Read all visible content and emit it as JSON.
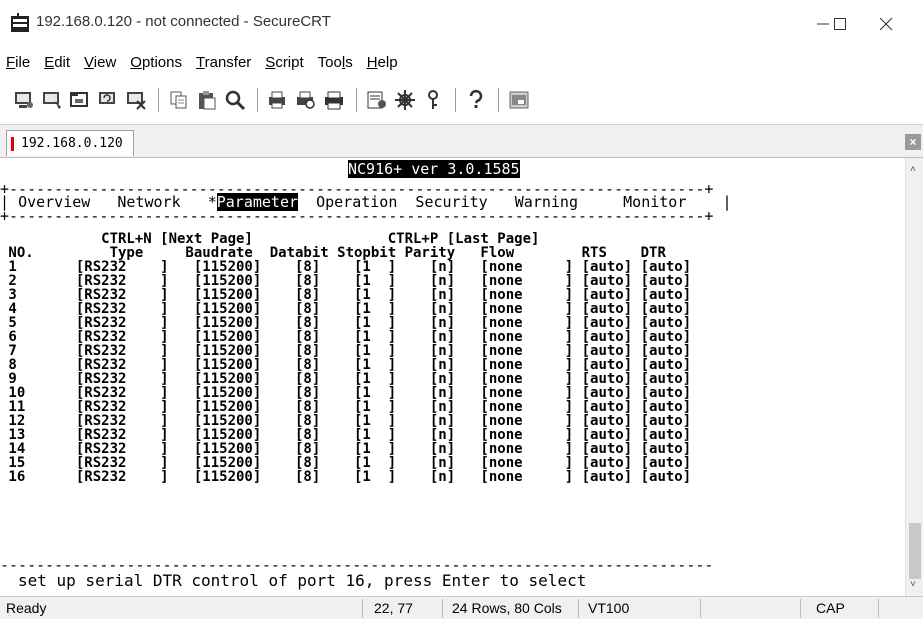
{
  "window": {
    "title": "192.168.0.120 - not connected - SecureCRT"
  },
  "menu": [
    {
      "label": "File",
      "accel": "F"
    },
    {
      "label": "Edit",
      "accel": "E"
    },
    {
      "label": "View",
      "accel": "V"
    },
    {
      "label": "Options",
      "accel": "O"
    },
    {
      "label": "Transfer",
      "accel": "T"
    },
    {
      "label": "Script",
      "accel": "S"
    },
    {
      "label": "Tools",
      "accel": "l"
    },
    {
      "label": "Help",
      "accel": "H"
    }
  ],
  "tab": {
    "label": "192.168.0.120",
    "close_glyph": "×"
  },
  "terminal": {
    "header": "NC916+ ver 3.0.1585",
    "divider_top": "+-----------------------------------------------------------------------------+",
    "nav_prefix": "| ",
    "nav_before": "Overview   Network   *",
    "nav_active": "Parameter",
    "nav_after": "  Operation  Security   Warning     Monitor    |",
    "divider_mid": "+-----------------------------------------------------------------------------+",
    "page_nav": "            CTRL+N [Next Page]                CTRL+P [Last Page]",
    "columns": " NO.         Type     Baudrate  Databit Stopbit Parity   Flow        RTS    DTR",
    "rows": [
      " 1       [RS232    ]   [115200]    [8]    [1  ]    [n]   [none     ] [auto] [auto]",
      " 2       [RS232    ]   [115200]    [8]    [1  ]    [n]   [none     ] [auto] [auto]",
      " 3       [RS232    ]   [115200]    [8]    [1  ]    [n]   [none     ] [auto] [auto]",
      " 4       [RS232    ]   [115200]    [8]    [1  ]    [n]   [none     ] [auto] [auto]",
      " 5       [RS232    ]   [115200]    [8]    [1  ]    [n]   [none     ] [auto] [auto]",
      " 6       [RS232    ]   [115200]    [8]    [1  ]    [n]   [none     ] [auto] [auto]",
      " 7       [RS232    ]   [115200]    [8]    [1  ]    [n]   [none     ] [auto] [auto]",
      " 8       [RS232    ]   [115200]    [8]    [1  ]    [n]   [none     ] [auto] [auto]",
      " 9       [RS232    ]   [115200]    [8]    [1  ]    [n]   [none     ] [auto] [auto]",
      " 10      [RS232    ]   [115200]    [8]    [1  ]    [n]   [none     ] [auto] [auto]",
      " 11      [RS232    ]   [115200]    [8]    [1  ]    [n]   [none     ] [auto] [auto]",
      " 12      [RS232    ]   [115200]    [8]    [1  ]    [n]   [none     ] [auto] [auto]",
      " 13      [RS232    ]   [115200]    [8]    [1  ]    [n]   [none     ] [auto] [auto]",
      " 14      [RS232    ]   [115200]    [8]    [1  ]    [n]   [none     ] [auto] [auto]",
      " 15      [RS232    ]   [115200]    [8]    [1  ]    [n]   [none     ] [auto] [auto]",
      " 16      [RS232    ]   [115200]    [8]    [1  ]    [n]   [none     ] [auto] [auto]"
    ],
    "divider_bottom": "-------------------------------------------------------------------------------",
    "prompt": "set up serial DTR control of port 16, press Enter to select",
    "scroll_up_glyph": "˄",
    "scroll_down_glyph": "˅"
  },
  "statusbar": {
    "state": "Ready",
    "cursor": "22, 77",
    "dimensions": "24 Rows, 80 Cols",
    "emulation": "VT100",
    "caps": "CAP"
  },
  "icons": {
    "app": "securecrt-app-icon",
    "toolbar": [
      "connect-icon",
      "quick-connect-icon",
      "connect-in-tab-icon",
      "reconnect-icon",
      "disconnect-icon",
      "copy-icon",
      "paste-icon",
      "find-icon",
      "print-setup-icon",
      "print-preview-icon",
      "print-icon",
      "session-options-icon",
      "global-options-icon",
      "key-map-icon",
      "help-icon",
      "sftp-icon"
    ]
  },
  "colors": {
    "inverse_bg": "#000000",
    "tab_marker": "#e00000"
  }
}
